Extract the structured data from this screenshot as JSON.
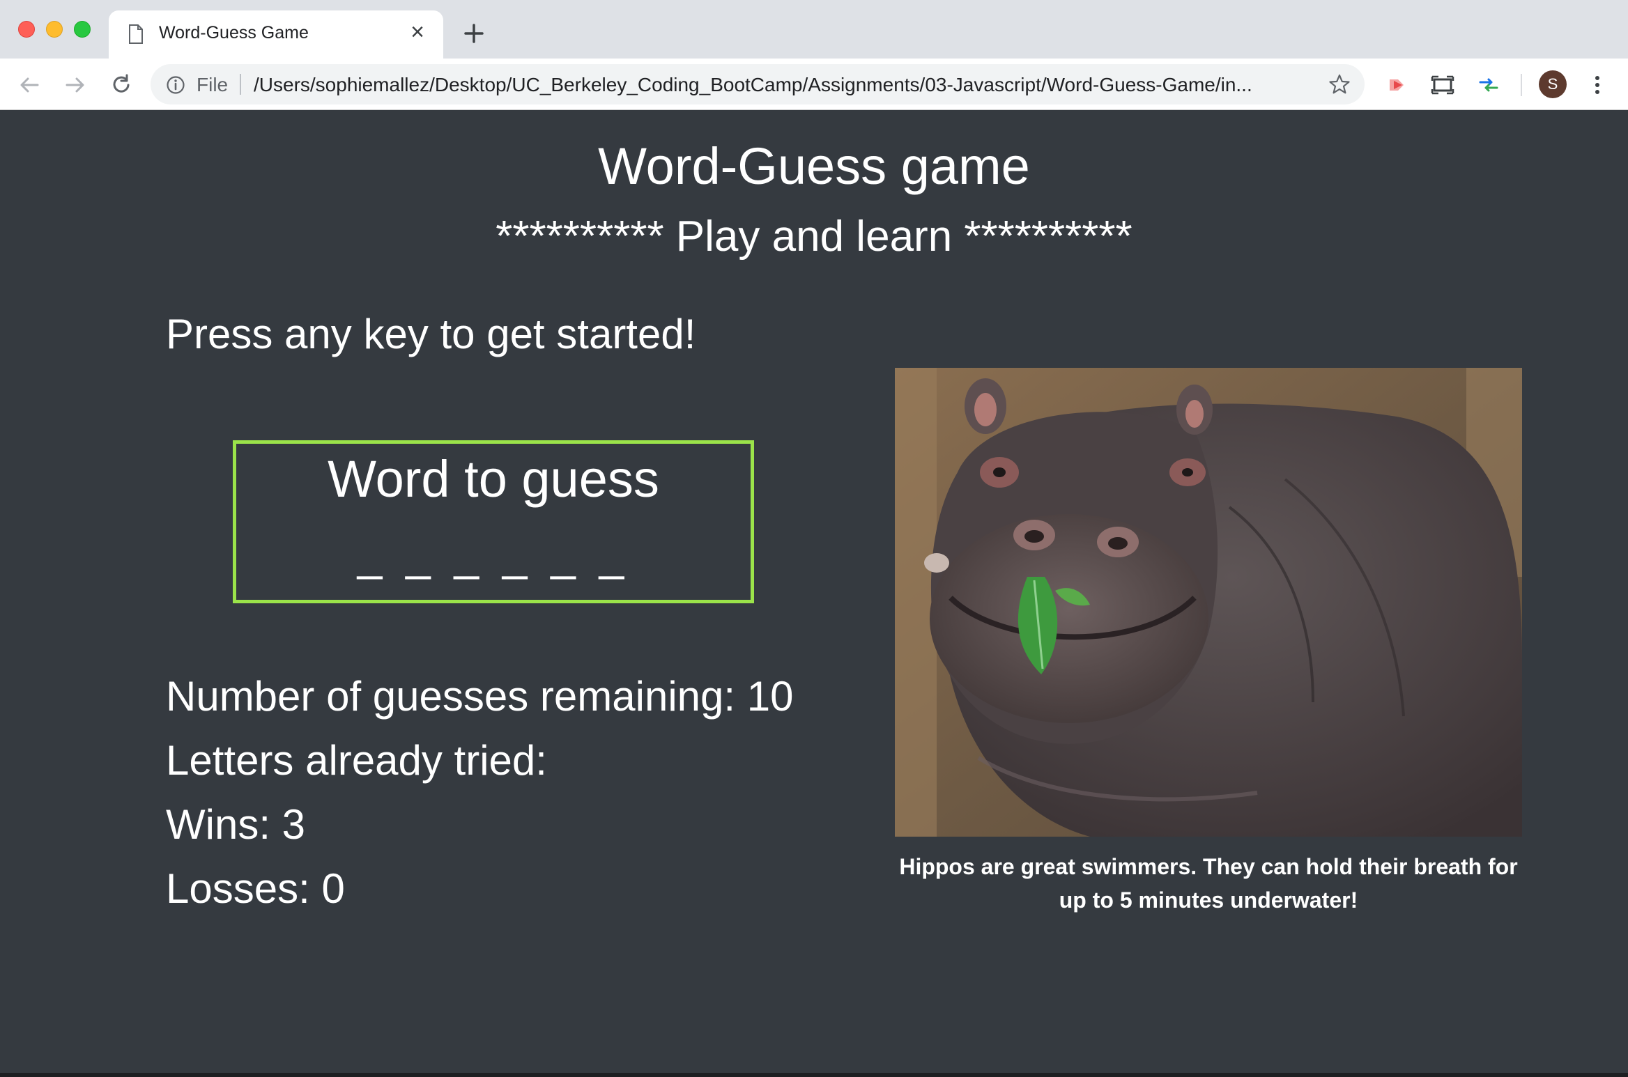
{
  "browser": {
    "tab_title": "Word-Guess Game",
    "close_glyph": "×",
    "omnibox": {
      "scheme_label": "File",
      "url": "/Users/sophiemallez/Desktop/UC_Berkeley_Coding_BootCamp/Assignments/03-Javascript/Word-Guess-Game/in..."
    },
    "avatar_letter": "S"
  },
  "game": {
    "title": "Word-Guess game",
    "subtitle": "********** Play and learn **********",
    "instruction": "Press any key to get started!",
    "word_box_label": "Word to guess",
    "word_blanks": "_ _ _ _ _ _",
    "guesses_remaining": "Number of guesses remaining: 10",
    "letters_tried": "Letters already tried:",
    "wins": "Wins: 3",
    "losses": "Losses: 0"
  },
  "photo": {
    "icon": "hippo-photo",
    "caption": "Hippos are great swimmers. They can hold their breath for up to 5 minutes underwater!"
  },
  "colors": {
    "page_bg": "#353a40",
    "word_box_border": "#9be34a",
    "text": "#ffffff"
  }
}
